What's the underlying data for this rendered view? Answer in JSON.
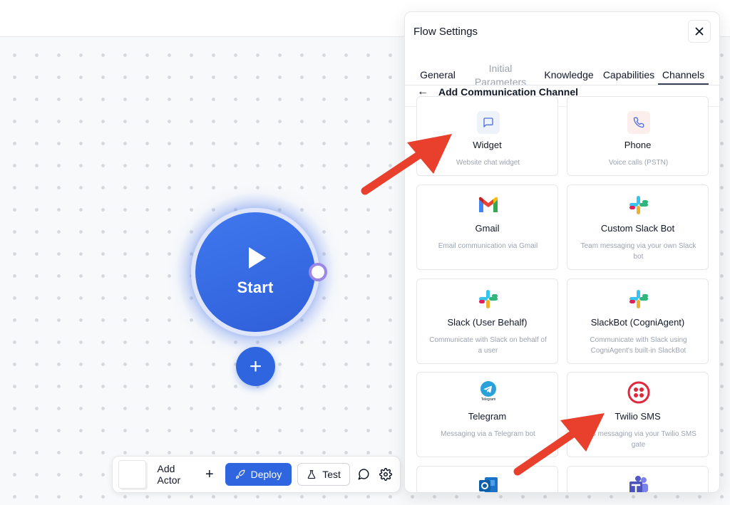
{
  "toolbar": {
    "add_actor_label": "Add Actor",
    "deploy_label": "Deploy",
    "test_label": "Test"
  },
  "canvas": {
    "start_label": "Start"
  },
  "panel": {
    "title": "Flow Settings",
    "tabs": [
      {
        "label": "General",
        "state": "normal"
      },
      {
        "label": "Initial Parameters",
        "state": "disabled"
      },
      {
        "label": "Knowledge",
        "state": "normal"
      },
      {
        "label": "Capabilities",
        "state": "normal"
      },
      {
        "label": "Channels",
        "state": "active"
      }
    ],
    "subheader_title": "Add Communication Channel",
    "channels": [
      {
        "name": "Widget",
        "description": "Website chat widget",
        "icon": "chat-bubble-icon"
      },
      {
        "name": "Phone",
        "description": "Voice calls (PSTN)",
        "icon": "phone-icon"
      },
      {
        "name": "Gmail",
        "description": "Email communication via Gmail",
        "icon": "gmail-icon"
      },
      {
        "name": "Custom Slack Bot",
        "description": "Team messaging via your own Slack bot",
        "icon": "slack-icon"
      },
      {
        "name": "Slack (User Behalf)",
        "description": "Communicate with Slack on behalf of a user",
        "icon": "slack-icon"
      },
      {
        "name": "SlackBot (CogniAgent)",
        "description": "Communicate with Slack using CogniAgent's built-in SlackBot",
        "icon": "slack-icon"
      },
      {
        "name": "Telegram",
        "description": "Messaging via a Telegram bot",
        "icon": "telegram-icon",
        "icon_caption": "Telegram"
      },
      {
        "name": "Twilio SMS",
        "description": "SMS messaging via your Twilio SMS gate",
        "icon": "twilio-icon"
      },
      {
        "name": "",
        "description": "",
        "icon": "outlook-icon"
      },
      {
        "name": "",
        "description": "",
        "icon": "teams-icon"
      }
    ]
  },
  "colors": {
    "accent": "#2f66e0",
    "start_node": "#3f78ee",
    "connector": "#9b87e8",
    "annotation_arrow": "#e8402c"
  }
}
